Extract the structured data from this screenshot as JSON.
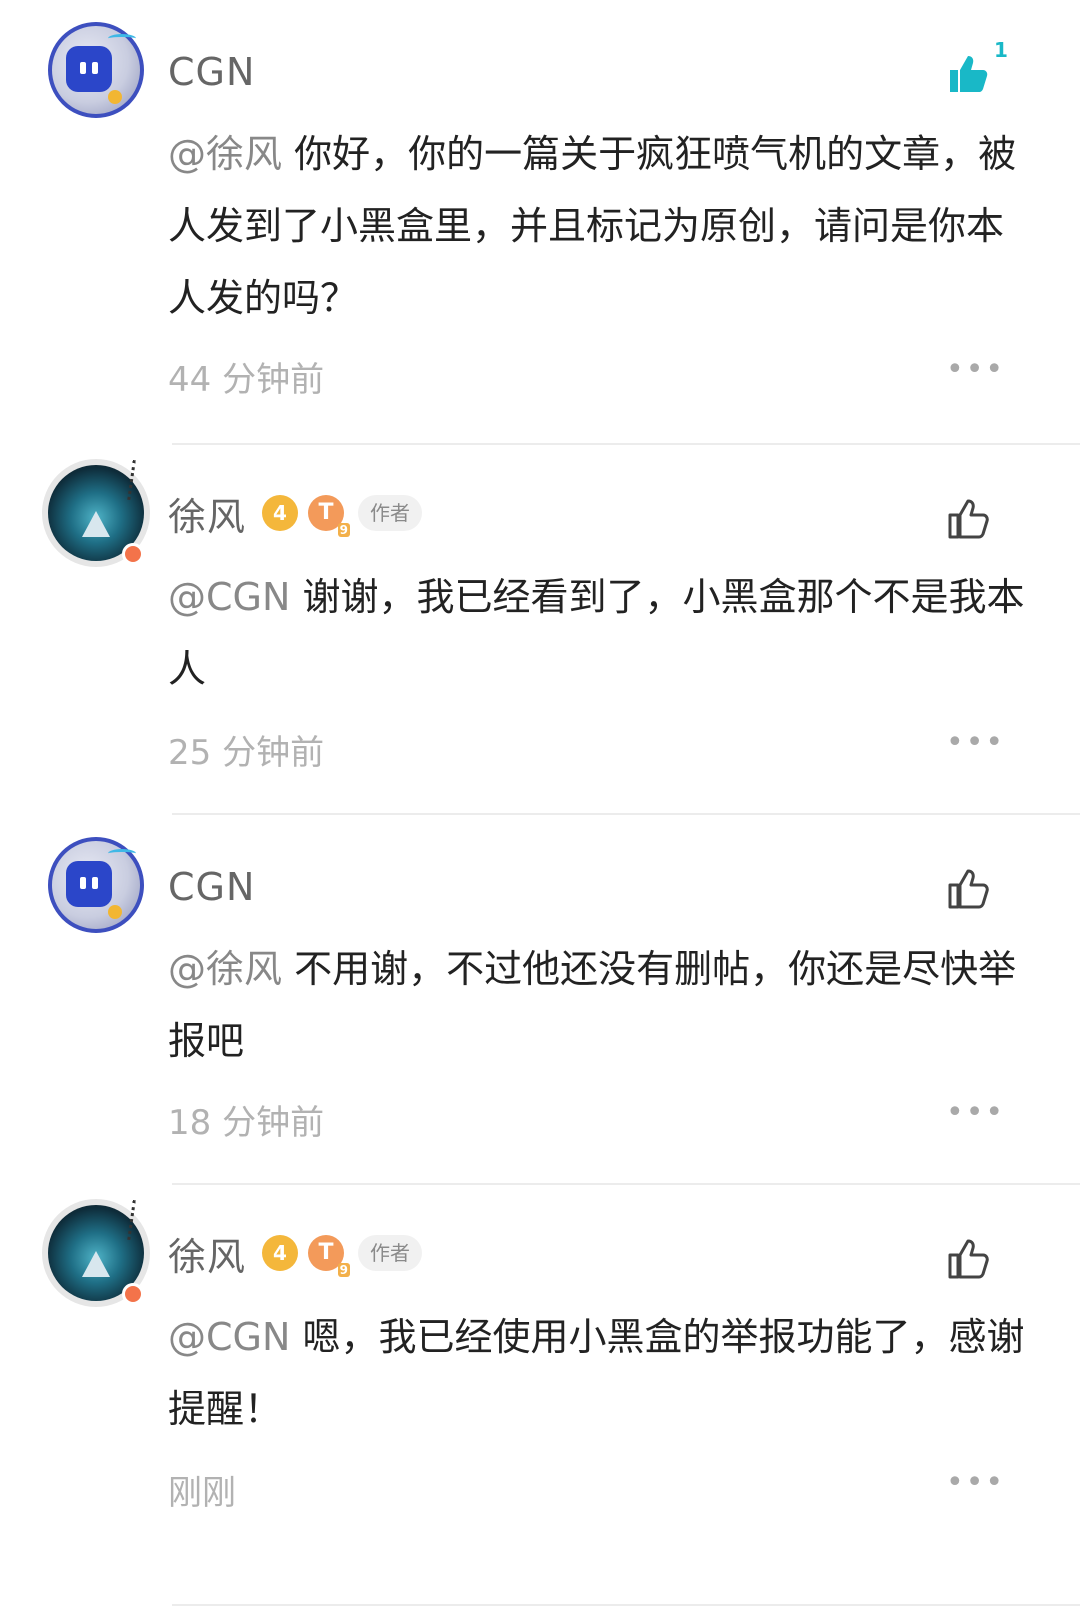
{
  "comments": [
    {
      "username": "CGN",
      "mention": "@徐风",
      "text": "你好，你的一篇关于疯狂喷气机的文章，被人发到了小黑盒里，并且标记为原创，请问是你本人发的吗？",
      "time": "44 分钟前",
      "like_count": "1",
      "liked": true
    },
    {
      "username": "徐风",
      "level_badge": "4",
      "t_badge": "T",
      "t_badge_sub": "9",
      "author_tag": "作者",
      "mention": "@CGN",
      "text": "谢谢，我已经看到了，小黑盒那个不是我本人",
      "time": "25 分钟前",
      "liked": false
    },
    {
      "username": "CGN",
      "mention": "@徐风",
      "text": "不用谢，不过他还没有删帖，你还是尽快举报吧",
      "time": "18 分钟前",
      "liked": false
    },
    {
      "username": "徐风",
      "level_badge": "4",
      "t_badge": "T",
      "t_badge_sub": "9",
      "author_tag": "作者",
      "mention": "@CGN",
      "text": "嗯，我已经使用小黑盒的举报功能了，感谢提醒！",
      "time": "刚刚",
      "liked": false
    }
  ],
  "more_icon": "ellipsis-icon",
  "colors": {
    "accent_like": "#19b8c7",
    "author_badge": "#f4b73b",
    "t_badge": "#f39a5a"
  }
}
